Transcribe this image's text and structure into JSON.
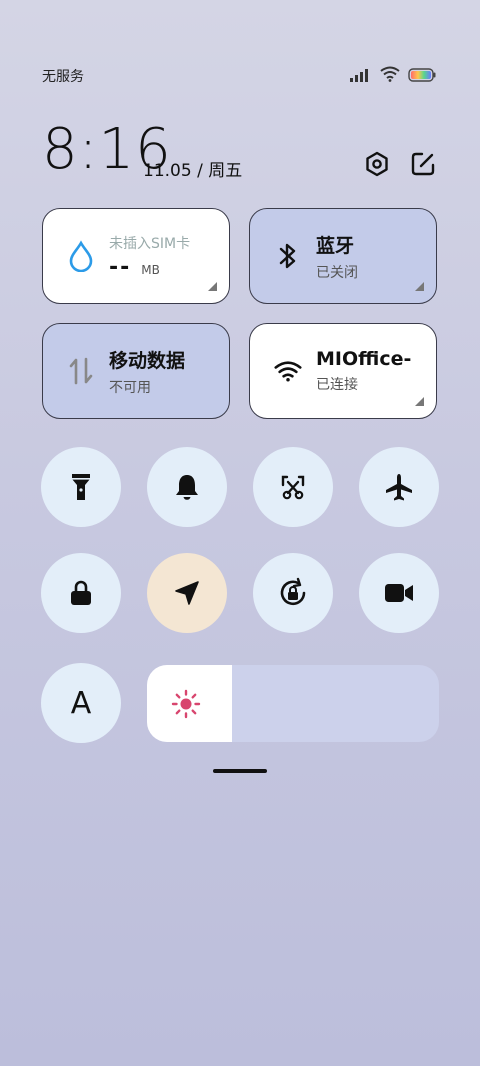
{
  "status": {
    "carrier": "无服务",
    "icons": [
      "signal-icon",
      "wifi-icon",
      "battery-icon"
    ],
    "battery_color": "#ff6b8a"
  },
  "header": {
    "time": "8:16",
    "date": "11.05 / 周五",
    "actions": [
      "settings-icon",
      "edit-icon"
    ]
  },
  "tiles": {
    "data": {
      "label": "未插入SIM卡",
      "value": "--",
      "unit": "MB",
      "accent": "#2c9be8"
    },
    "bluetooth": {
      "title": "蓝牙",
      "subtitle": "已关闭"
    },
    "mobile": {
      "title": "移动数据",
      "subtitle": "不可用"
    },
    "wifi": {
      "title": "MIOffice-",
      "subtitle": "已连接"
    }
  },
  "toggles": {
    "row1": [
      "flashlight-icon",
      "bell-icon",
      "screenshot-icon",
      "airplane-icon"
    ],
    "row2": [
      "lock-icon",
      "location-icon",
      "rotation-lock-icon",
      "video-camera-icon"
    ],
    "font_button": "A"
  },
  "brightness": {
    "level": 0.29,
    "icon_color": "#d8456e"
  }
}
